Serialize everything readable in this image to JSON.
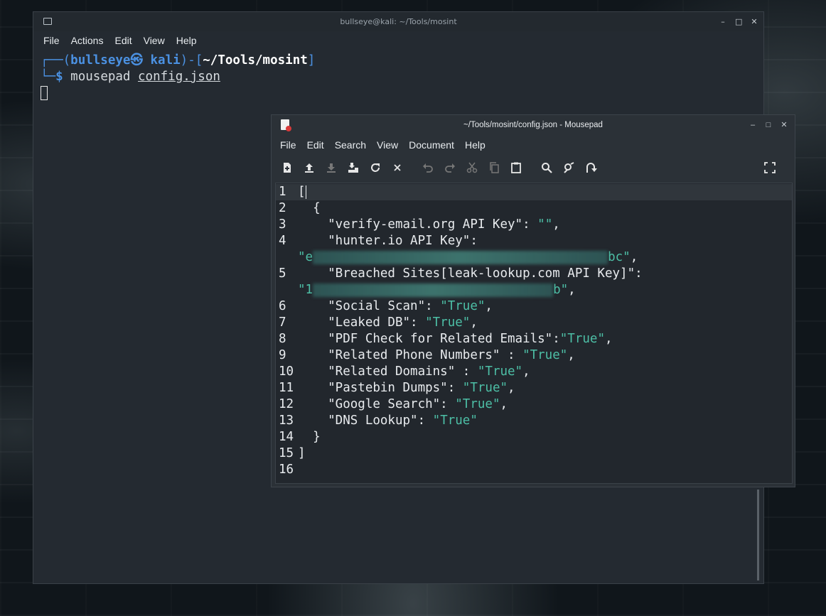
{
  "terminal": {
    "title": "bullseye@kali: ~/Tools/mosint",
    "menu": [
      "File",
      "Actions",
      "Edit",
      "View",
      "Help"
    ],
    "prompt": {
      "box_open": "┌──(",
      "user": "bullseye",
      "skull": "㉿",
      "host": "kali",
      "mid": ")-[",
      "cwd": "~/Tools/mosint",
      "close": "]",
      "line2_prefix": "└─",
      "dollar": "$",
      "command": "mousepad",
      "arg": "config.json"
    },
    "controls": {
      "minimize": "–",
      "maximize": "□",
      "close": "✕"
    }
  },
  "mousepad": {
    "title": "~/Tools/mosint/config.json - Mousepad",
    "menu": [
      "File",
      "Edit",
      "Search",
      "View",
      "Document",
      "Help"
    ],
    "toolbar_icons": [
      "new-document-icon",
      "open-icon",
      "save-icon",
      "save-as-icon",
      "reload-icon",
      "close-tab-icon",
      "undo-icon",
      "redo-icon",
      "cut-icon",
      "copy-icon",
      "paste-icon",
      "find-icon",
      "find-replace-icon",
      "goto-icon",
      "fullscreen-icon"
    ],
    "lines": [
      {
        "n": "1",
        "text": "["
      },
      {
        "n": "2",
        "text": "  {"
      },
      {
        "n": "3",
        "key": "    \"verify-email.org API Key\": ",
        "val": "\"\"",
        "end": ","
      },
      {
        "n": "4",
        "key": "    \"hunter.io API Key\":",
        "val": "",
        "end": ""
      },
      {
        "n": "",
        "val_pre": "\"e",
        "val_post": "bc\"",
        "end": ","
      },
      {
        "n": "5",
        "key": "    \"Breached Sites[leak-lookup.com API Key]\":",
        "val": "",
        "end": ""
      },
      {
        "n": "",
        "val_pre": "\"1",
        "val_post": "b\"",
        "end": ","
      },
      {
        "n": "6",
        "key": "    \"Social Scan\": ",
        "val": "\"True\"",
        "end": ","
      },
      {
        "n": "7",
        "key": "    \"Leaked DB\": ",
        "val": "\"True\"",
        "end": ","
      },
      {
        "n": "8",
        "key": "    \"PDF Check for Related Emails\":",
        "val": "\"True\"",
        "end": ","
      },
      {
        "n": "9",
        "key": "    \"Related Phone Numbers\" : ",
        "val": "\"True\"",
        "end": ","
      },
      {
        "n": "10",
        "key": "    \"Related Domains\" : ",
        "val": "\"True\"",
        "end": ","
      },
      {
        "n": "11",
        "key": "    \"Pastebin Dumps\": ",
        "val": "\"True\"",
        "end": ","
      },
      {
        "n": "12",
        "key": "    \"Google Search\": ",
        "val": "\"True\"",
        "end": ","
      },
      {
        "n": "13",
        "key": "    \"DNS Lookup\": ",
        "val": "\"True\"",
        "end": ""
      },
      {
        "n": "14",
        "text": "  }"
      },
      {
        "n": "15",
        "text": "]"
      },
      {
        "n": "16",
        "text": ""
      }
    ]
  },
  "colors": {
    "string": "#4dbfa6",
    "prompt_blue": "#4b91e2"
  }
}
